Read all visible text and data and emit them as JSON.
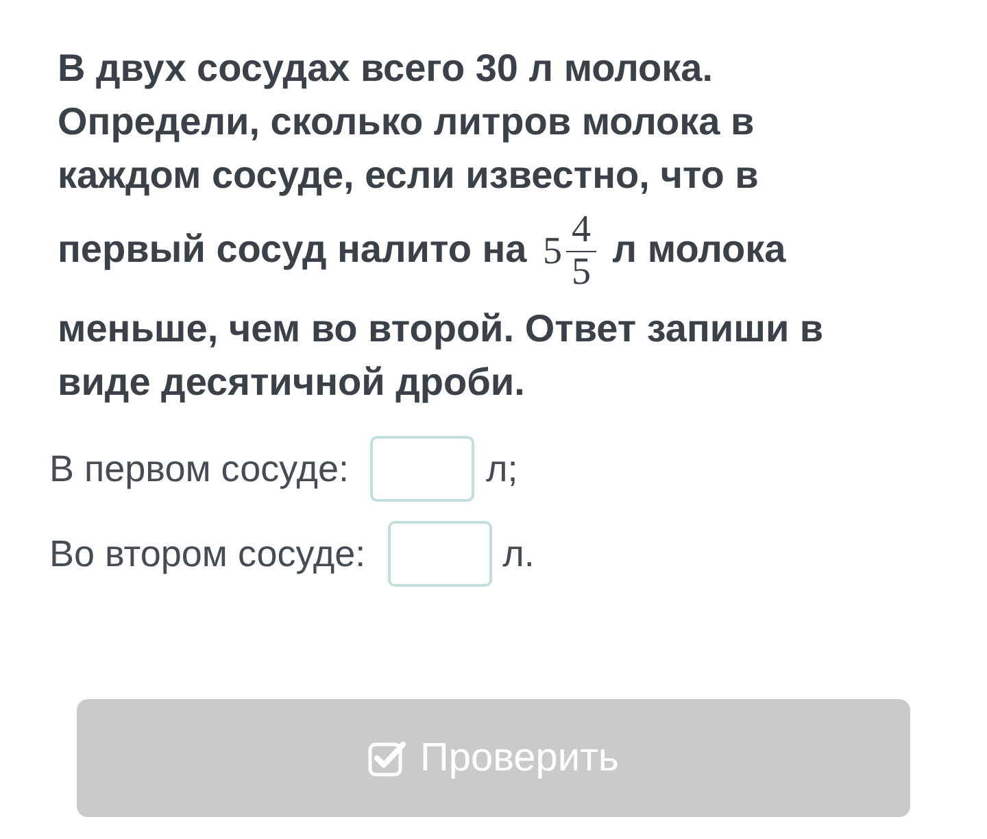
{
  "question": {
    "before": "В двух сосудах всего 30 л молока. Определи, сколько литров молока в каждом сосуде, если известно, что в первый сосуд налито на",
    "whole": "5",
    "numerator": "4",
    "denominator": "5",
    "after": "л молока меньше, чем во второй. Ответ запиши в виде десятичной дроби."
  },
  "answers": [
    {
      "label": "В первом сосуде:",
      "unit": "л;"
    },
    {
      "label": "Во втором сосуде:",
      "unit": "л."
    }
  ],
  "check_button": {
    "label": "Проверить",
    "disabled": true
  }
}
